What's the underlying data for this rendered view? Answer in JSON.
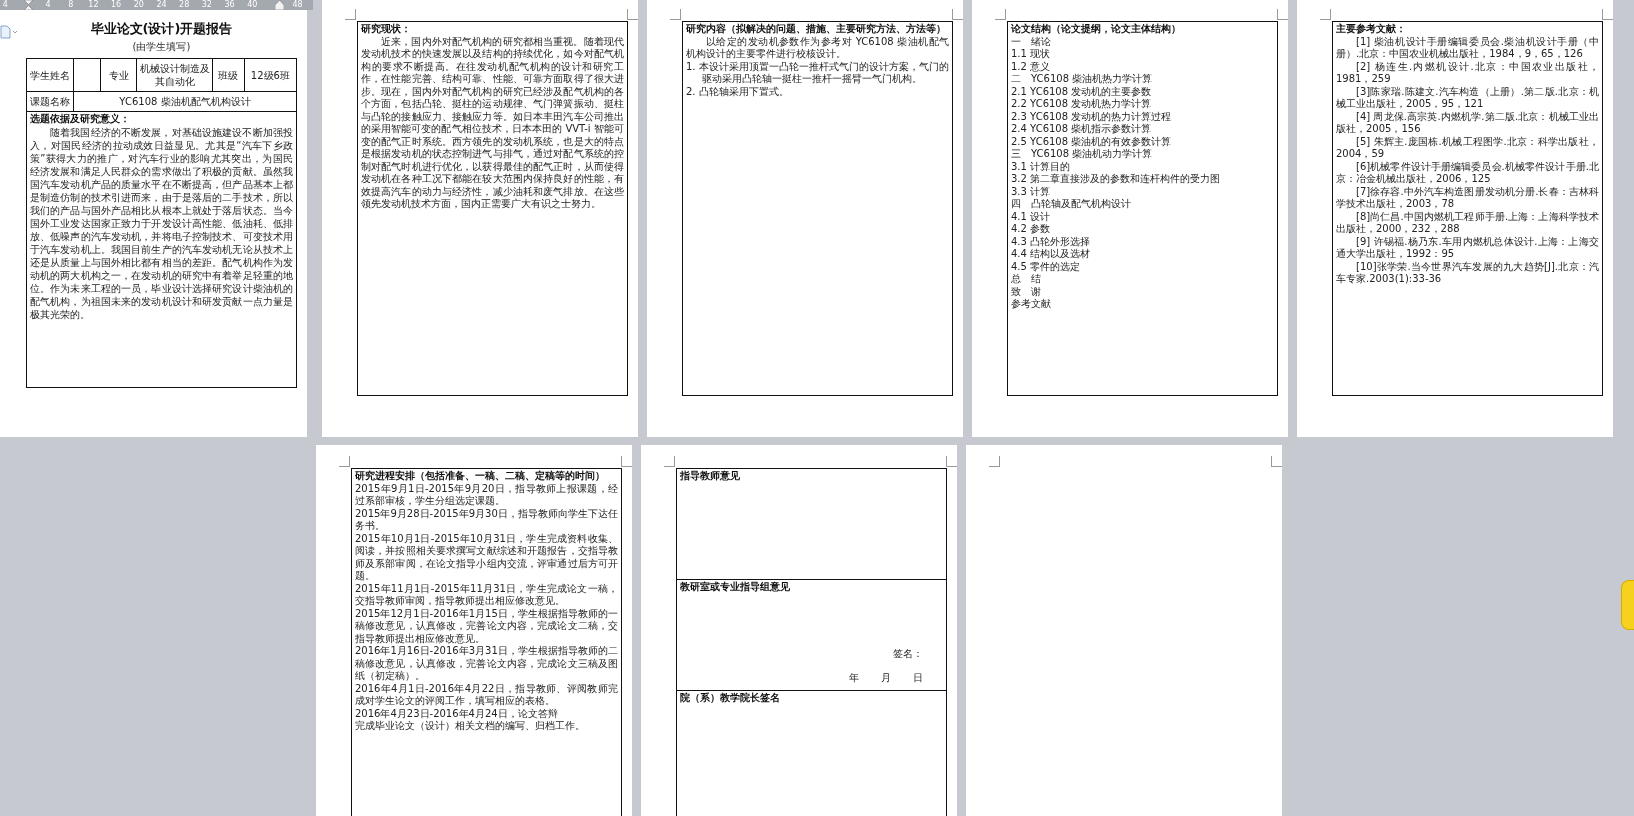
{
  "ruler": {
    "ticks": [
      "4",
      "4",
      "8",
      "12",
      "16",
      "20",
      "24",
      "28",
      "32",
      "36",
      "40",
      "48"
    ]
  },
  "rows": [
    {
      "pages": [
        {
          "kind": "cover",
          "title": "毕业论文(设计)开题报告",
          "subtitle": "(由学生填写)",
          "info_table": [
            {
              "cells": [
                {
                  "text": "学生姓名"
                },
                {},
                {
                  "text": "专业"
                },
                {
                  "text": "机械设计制造及其自动化"
                },
                {
                  "text": "班级"
                },
                {
                  "text": "12级6班"
                }
              ]
            },
            {
              "cells": [
                {
                  "text": "课题名称"
                },
                {
                  "text": "YC6108 柴油机配气机构设计"
                }
              ]
            }
          ],
          "sections": [
            {
              "blocks": [
                {
                  "kind": "heading",
                  "text": "选题依据及研究意义："
                },
                {
                  "kind": "paragraph",
                  "text": "随着我国经济的不断发展，对基础设施建设不断加强投入，对国民经济的拉动成效日益显见。尤其是“汽车下乡政策”获得大力的推广，对汽车行业的影响尤其突出，为国民经济发展和满足人民群众的需求做出了积极的贡献。虽然我国汽车发动机产品的质量水平在不断提高，但产品基本上都是制造仿制的技术引进而来，由于是落后的二手技术，所以我们的产品与国外产品相比从根本上就处于落后状态。当今国外工业发达国家正致力于开发设计高性能、低油耗、低排放、低噪声的汽车发动机，并将电子控制技术、可变技术用于汽车发动机上。我国目前生产的汽车发动机无论从技术上还是从质量上与国外相比都有相当的差距。配气机构作为发动机的两大机构之一，在发动机的研究中有着举足轻重的地位。作为未来工程的一员，毕业设计选择研究设计柴油机的配气机构，为祖国未来的发动机设计和研发贡献一点力量是极其光荣的。"
                }
              ]
            }
          ]
        },
        {
          "kind": "text",
          "sections": [
            {
              "blocks": [
                {
                  "kind": "heading",
                  "text": "研究现状："
                },
                {
                  "kind": "paragraph",
                  "text": "近来，国内外对配气机构的研究都相当重视。随着现代发动机技术的快速发展以及结构的持续优化，如今对配气机构的要求不断提高。在往发动机配气机构的设计和研究工作，在性能完善、结构可靠、性能、可靠方面取得了很大进步。现在，国内外对配气机构的研究已经涉及配气机构的各个方面，包括凸轮、挺柱的运动规律、气门弹簧振动、挺柱与凸轮的接触应力、接触应力等。如日本丰田汽车公司推出的采用智能可变的配气相位技术，日本本田的 VVT-i 智能可变的配气正时系统。西方领先的发动机系统，也是大的特点是根据发动机的状态控制进气与排气，通过对配气系统的控制对配气时机进行优化，以获得最佳的配气正时，从而使得发动机在各种工况下都能在较大范围内保持良好的性能，有效提高汽车的动力与经济性，减少油耗和废气排放。在这些领先发动机技术方面，国内正需要广大有识之士努力。"
                }
              ]
            }
          ]
        },
        {
          "kind": "text",
          "sections": [
            {
              "blocks": [
                {
                  "kind": "heading",
                  "text": "研究内容（拟解决的问题、措施、主要研究方法、方法等）"
                },
                {
                  "kind": "paragraph",
                  "text": "以给定的发动机参数作为参考对 YC6108 柴油机配气机构设计的主要零件进行校核设计。"
                },
                {
                  "kind": "numbered",
                  "text": "1.  本设计采用顶置一凸轮一推杆式气门的设计方案，气门的驱动采用凸轮轴一挺柱一推杆一摇臂一气门机构。"
                },
                {
                  "kind": "numbered",
                  "text": "2.  凸轮轴采用下置式。"
                }
              ]
            }
          ]
        },
        {
          "kind": "text",
          "sections": [
            {
              "blocks": [
                {
                  "kind": "heading",
                  "text": "论文结构（论文提纲，论文主体结构）"
                },
                {
                  "kind": "line",
                  "text": "一　绪论"
                },
                {
                  "kind": "line",
                  "text": "1.1 现状"
                },
                {
                  "kind": "line",
                  "text": "1.2 意义"
                },
                {
                  "kind": "line",
                  "text": "二　YC6108 柴油机热力学计算"
                },
                {
                  "kind": "line",
                  "text": "2.1 YC6108 发动机的主要参数"
                },
                {
                  "kind": "line",
                  "text": "2.2 YC6108 发动机热力学计算"
                },
                {
                  "kind": "line",
                  "text": "2.3 YC6108 发动机的热力计算过程"
                },
                {
                  "kind": "line",
                  "text": "2.4 YC6108 柴机指示参数计算"
                },
                {
                  "kind": "line",
                  "text": "2.5 YC6108 柴油机的有效参数计算"
                },
                {
                  "kind": "line",
                  "text": "三　YC6108 柴油机动力学计算"
                },
                {
                  "kind": "line",
                  "text": "3.1 计算目的"
                },
                {
                  "kind": "line",
                  "text": "3.2 第二章直接涉及的参数和连杆构件的受力图"
                },
                {
                  "kind": "line",
                  "text": "3.3 计算"
                },
                {
                  "kind": "line",
                  "text": "四　凸轮轴及配气机构设计"
                },
                {
                  "kind": "line",
                  "text": "4.1 设计"
                },
                {
                  "kind": "line",
                  "text": "4.2 参数"
                },
                {
                  "kind": "line",
                  "text": "4.3 凸轮外形选择"
                },
                {
                  "kind": "line",
                  "text": "4.4 结构以及选材"
                },
                {
                  "kind": "line",
                  "text": "4.5 零件的选定"
                },
                {
                  "kind": "line",
                  "text": "总　结"
                },
                {
                  "kind": "line",
                  "text": "致　谢"
                },
                {
                  "kind": "line",
                  "text": "参考文献"
                }
              ]
            }
          ]
        },
        {
          "kind": "text",
          "sections": [
            {
              "blocks": [
                {
                  "kind": "heading",
                  "text": "主要参考文献："
                },
                {
                  "kind": "paragraph",
                  "text": "[1] 柴油机设计手册编辑委员会.柴油机设计手册（中册）.北京：中国农业机械出版社，1984，9，65，126"
                },
                {
                  "kind": "paragraph",
                  "text": "[2] 杨连生.内燃机设计.北京：中国农业出版社，1981，259"
                },
                {
                  "kind": "paragraph",
                  "text": "[3]陈家瑞.陈建文.汽车构造（上册）.第二版.北京：机械工业出版社，2005，95，121"
                },
                {
                  "kind": "paragraph",
                  "text": "[4] 周龙保.高宗英.内燃机学.第二版.北京：机械工业出版社，2005，156"
                },
                {
                  "kind": "paragraph",
                  "text": "[5] 朱辉主.庞国栋.机械工程图学.北京：科学出版社，2004，59"
                },
                {
                  "kind": "paragraph",
                  "text": "[6]机械零件设计手册编辑委员会.机械零件设计手册.北京：冶金机械出版社，2006，125"
                },
                {
                  "kind": "paragraph",
                  "text": "[7]徐存容.中外汽车构造图册发动机分册.长春：吉林科学技术出版社，2003，78"
                },
                {
                  "kind": "paragraph",
                  "text": "[8]尚仁昌.中国内燃机工程师手册.上海：上海科学技术出版社，2000，232，288"
                },
                {
                  "kind": "paragraph",
                  "text": "[9] 许锡福.杨乃东.车用内燃机总体设计.上海：上海交通大学出版社，1992：95"
                },
                {
                  "kind": "paragraph",
                  "text": "[10]张学荣.当今世界汽车发展的九大趋势[J].北京：汽车专家.2003(1):33-36"
                }
              ]
            }
          ]
        }
      ]
    },
    {
      "pages": [
        {
          "kind": "text",
          "sections": [
            {
              "blocks": [
                {
                  "kind": "heading",
                  "text": "研究进程安排（包括准备、一稿、二稿、定稿等的时间）"
                },
                {
                  "kind": "line",
                  "text": "2015年9月1日-2015年9月20日，指导教师上报课题，经过系部审核，学生分组选定课题。"
                },
                {
                  "kind": "line",
                  "text": "2015年9月28日-2015年9月30日，指导教师向学生下达任务书。"
                },
                {
                  "kind": "line",
                  "text": "2015年10月1日-2015年10月31日，学生完成资料收集、阅读，并按照相关要求撰写文献综述和开题报告，交指导教师及系部审阅，在论文指导小组内交流，评审通过后方可开题。"
                },
                {
                  "kind": "line",
                  "text": "2015年11月1日-2015年11月31日，学生完成论文一稿，交指导教师审阅，指导教师提出相应修改意见。"
                },
                {
                  "kind": "line",
                  "text": "2015年12月1日-2016年1月15日，学生根据指导教师的一稿修改意见，认真修改，完善论文内容，完成论文二稿，交指导教师提出相应修改意见。"
                },
                {
                  "kind": "line",
                  "text": "2016年1月16日-2016年3月31日，学生根据指导教师的二稿修改意见，认真修改，完善论文内容，完成论文三稿及图纸（初定稿）。"
                },
                {
                  "kind": "line",
                  "text": "2016年4月1日-2016年4月22日，指导教师、评阅教师完成对学生论文的评阅工作，填写相应的表格。"
                },
                {
                  "kind": "line",
                  "text": "2016年4月23日-2016年4月24日，论文答辩"
                },
                {
                  "kind": "line",
                  "text": "完成毕业论文（设计）相关文档的编写、归档工作。"
                }
              ]
            }
          ]
        },
        {
          "kind": "text",
          "sections": [
            {
              "blocks": [
                {
                  "kind": "heading",
                  "text": "指导教师意见"
                }
              ]
            },
            {
              "blocks": [
                {
                  "kind": "heading",
                  "text": "教研室或专业指导组意见"
                },
                {
                  "kind": "signature",
                  "label": "签名：",
                  "date": [
                    "年",
                    "月",
                    "日"
                  ]
                }
              ]
            },
            {
              "blocks": [
                {
                  "kind": "heading",
                  "text": "院（系）教学院长签名"
                }
              ]
            }
          ]
        },
        {
          "kind": "blank"
        }
      ]
    }
  ]
}
